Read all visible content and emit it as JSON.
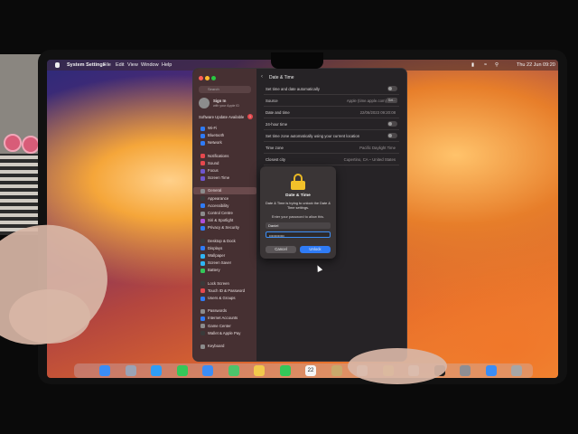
{
  "menubar": {
    "app": "System Settings",
    "menus": [
      "File",
      "Edit",
      "View",
      "Window",
      "Help"
    ],
    "clock": "Thu 22 Jun  09:20"
  },
  "sidebar": {
    "search_placeholder": "Search",
    "user_name": "Sign In",
    "user_sub": "with your Apple ID",
    "update_notice": "Software Update Available",
    "update_count": "1",
    "items": [
      {
        "label": "Wi-Fi",
        "color": "#2f7bf5"
      },
      {
        "label": "Bluetooth",
        "color": "#2f7bf5"
      },
      {
        "label": "Network",
        "color": "#2f7bf5"
      },
      {
        "label": "Notifications",
        "color": "#e5484d"
      },
      {
        "label": "Sound",
        "color": "#e5484d"
      },
      {
        "label": "Focus",
        "color": "#6e56cf"
      },
      {
        "label": "Screen Time",
        "color": "#6e56cf"
      },
      {
        "label": "General",
        "color": "#8b8b8b"
      },
      {
        "label": "Appearance",
        "color": "#3a3a3a"
      },
      {
        "label": "Accessibility",
        "color": "#2f7bf5"
      },
      {
        "label": "Control Centre",
        "color": "#8b8b8b"
      },
      {
        "label": "Siri & Spotlight",
        "color": "#b04fd8"
      },
      {
        "label": "Privacy & Security",
        "color": "#2f7bf5"
      },
      {
        "label": "Desktop & Dock",
        "color": "#3a3a3a"
      },
      {
        "label": "Displays",
        "color": "#2f7bf5"
      },
      {
        "label": "Wallpaper",
        "color": "#2fb5f5"
      },
      {
        "label": "Screen Saver",
        "color": "#2fb5f5"
      },
      {
        "label": "Battery",
        "color": "#34c759"
      },
      {
        "label": "Lock Screen",
        "color": "#3a3a3a"
      },
      {
        "label": "Touch ID & Password",
        "color": "#e5484d"
      },
      {
        "label": "Users & Groups",
        "color": "#2f7bf5"
      },
      {
        "label": "Passwords",
        "color": "#8b8b8b"
      },
      {
        "label": "Internet Accounts",
        "color": "#2f7bf5"
      },
      {
        "label": "Game Center",
        "color": "#8b8b8b"
      },
      {
        "label": "Wallet & Apple Pay",
        "color": "#3a3a3a"
      },
      {
        "label": "Keyboard",
        "color": "#8b8b8b"
      }
    ]
  },
  "content": {
    "title": "Date & Time",
    "rows": [
      {
        "label": "Set time and date automatically",
        "value": "",
        "control": "toggle"
      },
      {
        "label": "Source",
        "value": "Apple (time.apple.com)",
        "control": "button",
        "button_label": "Set..."
      },
      {
        "label": "Date and time",
        "value": "22/06/2023 09:20:08",
        "control": ""
      },
      {
        "label": "24-hour time",
        "value": "",
        "control": "toggle"
      },
      {
        "label": "Set time zone automatically using your current location",
        "value": "",
        "control": "toggle"
      },
      {
        "label": "Time zone",
        "value": "Pacific Daylight Time",
        "control": ""
      },
      {
        "label": "Closest city",
        "value": "Cupertino, CA – United States",
        "control": "dropdown"
      }
    ]
  },
  "dialog": {
    "title": "Date & Time",
    "message": "Date & Time is trying to unlock the Date & Time settings.",
    "prompt": "Enter your password to allow this.",
    "username": "Daniel",
    "password_mask": "••••••••••••",
    "cancel_label": "Cancel",
    "unlock_label": "Unlock"
  },
  "dock": {
    "apps": [
      {
        "name": "finder-icon",
        "color": "#3b8df5"
      },
      {
        "name": "launchpad-icon",
        "color": "#9aa3b5"
      },
      {
        "name": "safari-icon",
        "color": "#2f9df5"
      },
      {
        "name": "messages-icon",
        "color": "#34c759"
      },
      {
        "name": "mail-icon",
        "color": "#3b8df5"
      },
      {
        "name": "maps-icon",
        "color": "#4cc36b"
      },
      {
        "name": "photos-icon",
        "color": "#f2c94c"
      },
      {
        "name": "facetime-icon",
        "color": "#34c759"
      },
      {
        "name": "calendar-icon",
        "color": "#f5f5f5"
      },
      {
        "name": "notes-app-icon",
        "color": "#c8a86b"
      },
      {
        "name": "reminders-icon",
        "color": "#f5f5f5"
      },
      {
        "name": "notes-icon",
        "color": "#f7d54a"
      },
      {
        "name": "freeform-icon",
        "color": "#f5f5f5"
      },
      {
        "name": "apple-tv-icon",
        "color": "#1c1c1c"
      },
      {
        "name": "settings-icon",
        "color": "#8e8e93"
      },
      {
        "name": "downloads-icon",
        "color": "#3b8df5"
      },
      {
        "name": "trash-icon",
        "color": "#a6a6a6"
      }
    ],
    "calendar_day": "22"
  }
}
